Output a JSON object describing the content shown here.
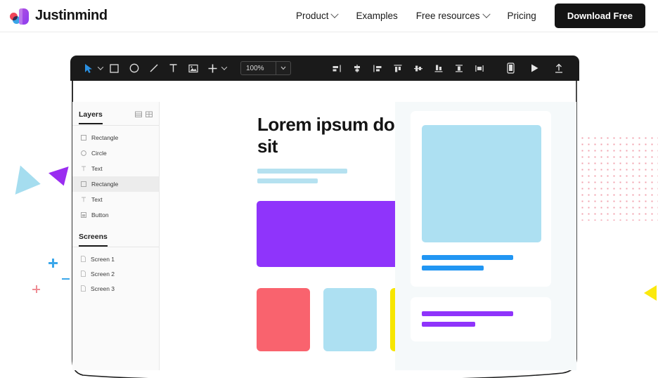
{
  "navbar": {
    "brand_name": "Justinmind",
    "links": [
      {
        "label": "Product",
        "has_caret": true
      },
      {
        "label": "Examples",
        "has_caret": false
      },
      {
        "label": "Free resources",
        "has_caret": true
      },
      {
        "label": "Pricing",
        "has_caret": false
      }
    ],
    "cta_label": "Download Free",
    "cta_bg": "#141414"
  },
  "editor": {
    "toolbar": {
      "tools": [
        {
          "name": "cursor-tool-icon",
          "caret": true
        },
        {
          "name": "rectangle-tool-icon",
          "caret": false
        },
        {
          "name": "ellipse-tool-icon",
          "caret": false
        },
        {
          "name": "line-tool-icon",
          "caret": false
        },
        {
          "name": "text-tool-icon",
          "caret": false
        },
        {
          "name": "image-tool-icon",
          "caret": false
        },
        {
          "name": "add-tool-icon",
          "caret": true
        }
      ],
      "zoom_value": "100%",
      "align_tools": [
        "align-left-icon",
        "align-center-horizontal-icon",
        "align-right-icon",
        "align-top-icon",
        "align-middle-vertical-icon",
        "align-bottom-icon",
        "distribute-vertical-icon",
        "distribute-horizontal-icon"
      ],
      "right_tools": [
        "mobile-device-icon",
        "preview-play-icon",
        "share-upload-icon"
      ]
    },
    "panel": {
      "layers_title": "Layers",
      "layers_view_icons": [
        "list-view-icon",
        "grid-view-icon"
      ],
      "layers": [
        {
          "label": "Rectangle",
          "icon": "rectangle-icon",
          "selected": false
        },
        {
          "label": "Circle",
          "icon": "circle-icon",
          "selected": false
        },
        {
          "label": "Text",
          "icon": "text-icon",
          "selected": false
        },
        {
          "label": "Rectangle",
          "icon": "rectangle-icon",
          "selected": true
        },
        {
          "label": "Text",
          "icon": "text-icon",
          "selected": false
        },
        {
          "label": "Button",
          "icon": "button-icon",
          "selected": false
        }
      ],
      "screens_title": "Screens",
      "screens": [
        {
          "label": "Screen 1",
          "icon": "page-icon"
        },
        {
          "label": "Screen 2",
          "icon": "page-icon"
        },
        {
          "label": "Screen 3",
          "icon": "page-icon"
        }
      ]
    },
    "canvas": {
      "hero_title": "Lorem ipsum dolor sit",
      "colors": {
        "purple_block": "#8F34FB",
        "swatch_red": "#F9636E",
        "swatch_blue": "#ADE0F2",
        "swatch_yellow": "#F7E600",
        "placeholder_lightblue": "#B5E1F0",
        "bar_blue": "#2196F3",
        "panel_bg": "#F5F9FA"
      }
    }
  },
  "decorations": {
    "triangle_blue": "#A5DDEF",
    "triangle_purple": "#9A2DF0",
    "triangle_yellow": "#FBE90D",
    "plus_blue": "#3BA7EA",
    "plus_red": "#EF8C94",
    "dot_grid": "#F2A0AD"
  }
}
